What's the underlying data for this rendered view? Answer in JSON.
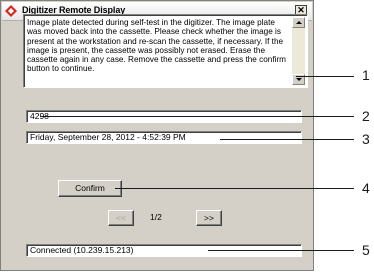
{
  "window": {
    "title": "Digitizer Remote Display",
    "close_label": "✕"
  },
  "message": {
    "text": "Image plate detected during self-test in the digitizer. The image plate was moved back into the cassette. Please check whether the image is present at the workstation and re-scan the cassette, if necessary. If the image is present, the cassette was possibly not erased. Erase the cassette again in any case. Remove the cassette and press the confirm button to continue."
  },
  "fields": {
    "id_value": "4298",
    "datetime_value": "Friday, September 28, 2012  -  4:52:39 PM"
  },
  "buttons": {
    "confirm_label": "Confirm",
    "prev_label": "<<",
    "next_label": ">>"
  },
  "paging": {
    "indicator": "1/2"
  },
  "status": {
    "text": "Connected (10.239.15.213)"
  },
  "callouts": [
    "1",
    "2",
    "3",
    "4",
    "5"
  ],
  "colors": {
    "window_bg": "#d4d0c8",
    "field_bg": "#ffffff",
    "callout_color": "#1a1a1a",
    "icon_red": "#d9261c"
  }
}
